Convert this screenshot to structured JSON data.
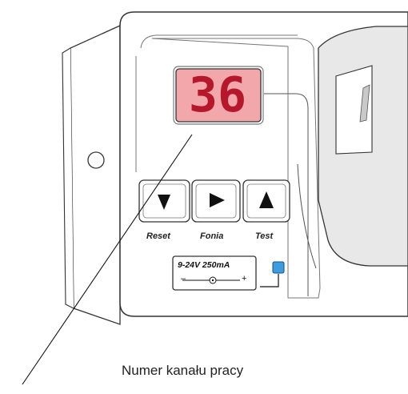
{
  "display": {
    "channel_value": "36"
  },
  "buttons": [
    {
      "label": "Reset",
      "icon": "down-arrow-icon"
    },
    {
      "label": "Fonia",
      "icon": "right-arrow-icon"
    },
    {
      "label": "Test",
      "icon": "up-arrow-icon"
    }
  ],
  "power": {
    "spec": "9-24V  250mA",
    "minus": "–",
    "plus": "+"
  },
  "caption": "Numer kanału pracy",
  "colors": {
    "display_bg": "#f2a7ab",
    "display_digits": "#b4182a",
    "led": "#3d9be0"
  }
}
